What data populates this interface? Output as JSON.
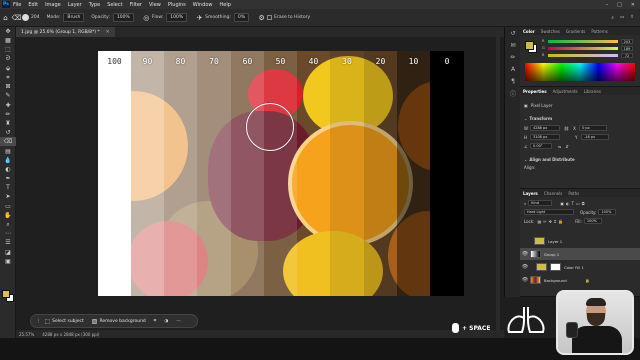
{
  "menubar": {
    "app_logo": "Ps",
    "items": [
      "File",
      "Edit",
      "Image",
      "Layer",
      "Type",
      "Select",
      "Filter",
      "View",
      "Plugins",
      "Window",
      "Help"
    ]
  },
  "options_bar": {
    "mode_label": "Mode:",
    "mode_value": "Brush",
    "opacity_label": "Opacity:",
    "opacity_value": "100%",
    "flow_label": "Flow:",
    "flow_value": "100%",
    "smoothing_label": "Smoothing:",
    "smoothing_value": "0%",
    "erase_history_label": "Erase to History",
    "brush_size": "204"
  },
  "document_tab": {
    "title": "1.jpg @ 25.6% (Group 1, RGB/8*) *"
  },
  "canvas": {
    "band_labels": [
      "100",
      "90",
      "80",
      "70",
      "60",
      "50",
      "40",
      "30",
      "20",
      "10",
      "0"
    ]
  },
  "task_bar": {
    "select_subject": "Select subject",
    "remove_background": "Remove background"
  },
  "status_bar": {
    "zoom": "25.57%",
    "doc_size": "4288 px x 2848 px (300 ppi)"
  },
  "key_hint": {
    "label": "+ SPACE"
  },
  "color_panel": {
    "tabs": [
      "Color",
      "Swatches",
      "Gradients",
      "Patterns"
    ],
    "active_tab": "Color",
    "channels": [
      {
        "label": "R",
        "value": "203"
      },
      {
        "label": "G",
        "value": "189"
      },
      {
        "label": "B",
        "value": "72"
      }
    ],
    "foreground_color": "#cbbd48"
  },
  "properties_panel": {
    "tabs": [
      "Properties",
      "Adjustments",
      "Libraries"
    ],
    "active_tab": "Properties",
    "layer_type": "Pixel Layer",
    "transform_heading": "Transform",
    "w_label": "W",
    "w_value": "4288 px",
    "x_label": "X",
    "x_value": "0 px",
    "h_label": "H",
    "h_value": "3108 px",
    "y_label": "Y",
    "y_value": "-18 px",
    "angle_value": "0.00°",
    "align_heading": "Align and Distribute",
    "align_sub": "Align:"
  },
  "layers_panel": {
    "tabs": [
      "Layers",
      "Channels",
      "Paths"
    ],
    "active_tab": "Layers",
    "kind_label": "Kind",
    "blend_mode": "Hard Light",
    "opacity_label": "Opacity:",
    "opacity_value": "100%",
    "lock_label": "Lock:",
    "fill_label": "Fill:",
    "fill_value": "100%",
    "layers": [
      {
        "name": "Layer 1"
      },
      {
        "name": "Group 1"
      },
      {
        "name": "Color Fill 1"
      },
      {
        "name": "Background"
      }
    ]
  },
  "colors": {
    "ui_bg": "#1e1e1e",
    "panel_bg": "#2b2b2b",
    "accent": "#31a8ff"
  }
}
